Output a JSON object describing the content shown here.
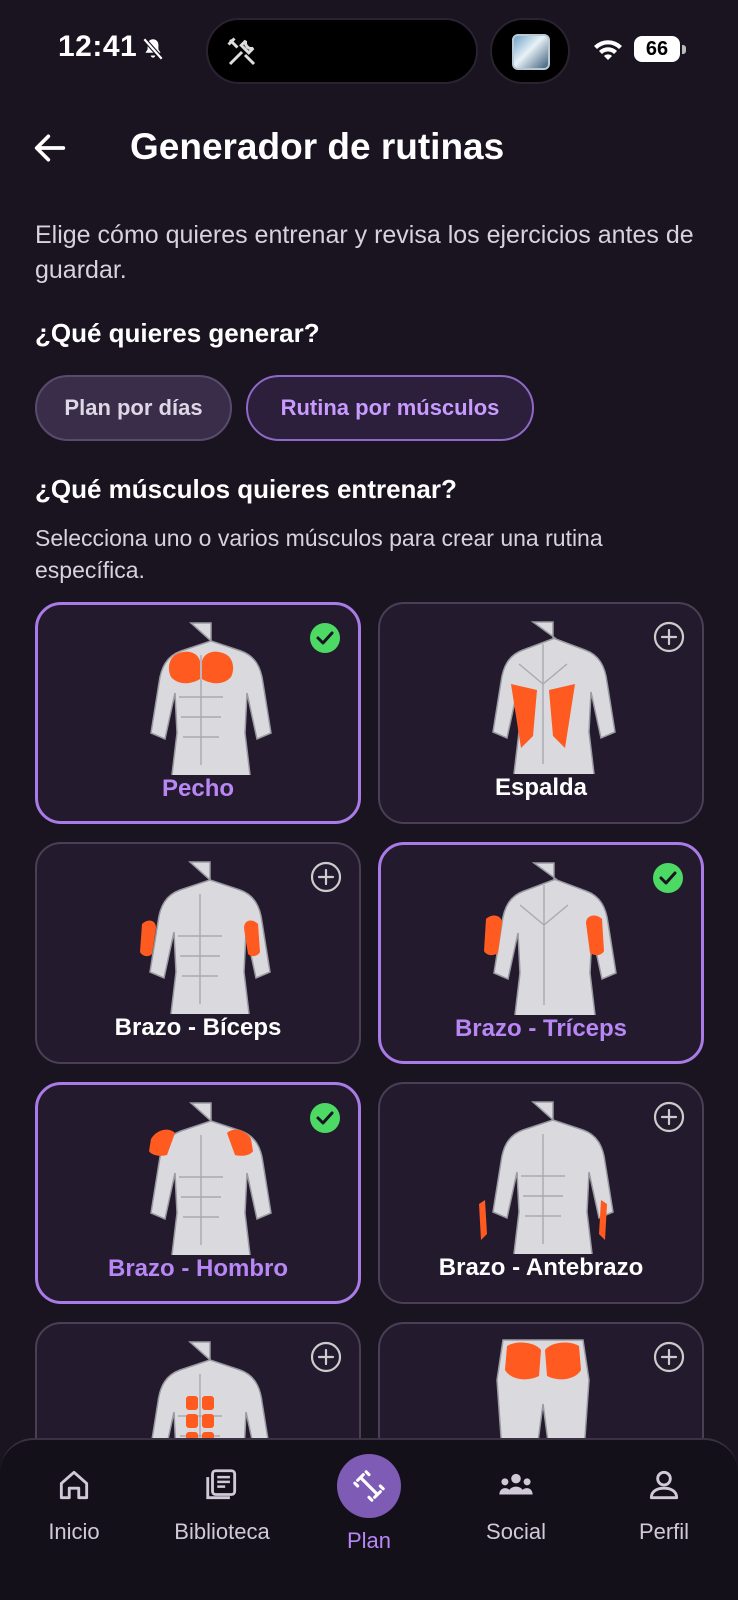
{
  "status": {
    "time": "12:41",
    "battery": "66"
  },
  "header": {
    "title": "Generador de rutinas"
  },
  "intro": "Elige cómo quieres entrenar y revisa los ejercicios antes de guardar.",
  "generate": {
    "question": "¿Qué quieres generar?",
    "options": [
      "Plan por días",
      "Rutina por músculos"
    ],
    "selected": "Rutina por músculos"
  },
  "muscles": {
    "question": "¿Qué músculos quieres entrenar?",
    "subtitle": "Selecciona uno o varios músculos para crear una rutina específica.",
    "items": [
      {
        "label": "Pecho",
        "selected": true
      },
      {
        "label": "Espalda",
        "selected": false
      },
      {
        "label": "Brazo - Bíceps",
        "selected": false
      },
      {
        "label": "Brazo - Tríceps",
        "selected": true
      },
      {
        "label": "Brazo - Hombro",
        "selected": true
      },
      {
        "label": "Brazo - Antebrazo",
        "selected": false
      },
      {
        "label": "",
        "selected": false
      },
      {
        "label": "",
        "selected": false
      }
    ]
  },
  "nav": {
    "items": [
      "Inicio",
      "Biblioteca",
      "Plan",
      "Social",
      "Perfil"
    ],
    "active": "Plan"
  },
  "colors": {
    "accent": "#a97be6",
    "highlight_muscle": "#ff5a1f",
    "check_green": "#4cd964",
    "background": "#1a1421"
  }
}
